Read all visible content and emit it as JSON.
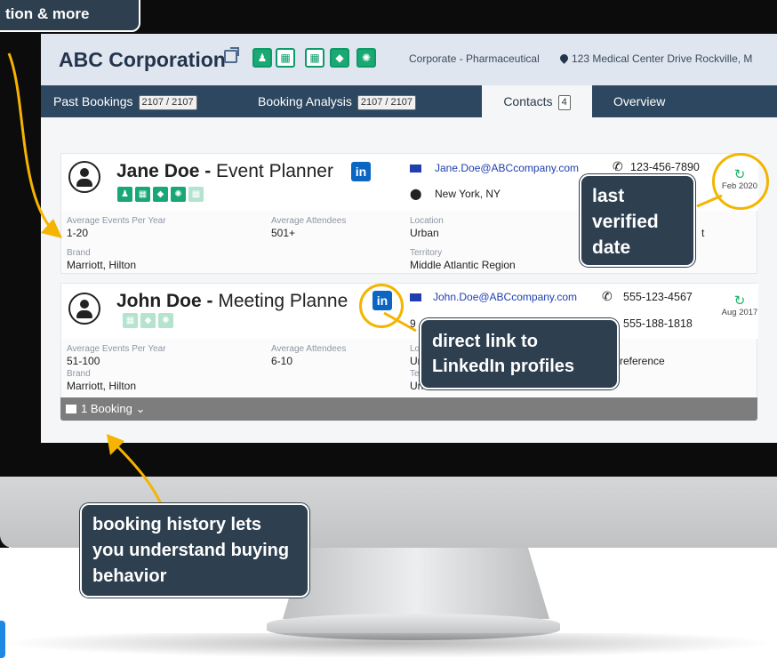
{
  "top_callout": "tion & more",
  "company": {
    "name": "ABC Corporation",
    "category": "Corporate - Pharmaceutical",
    "address": "123 Medical Center Drive Rockville, M"
  },
  "tabs": [
    {
      "label": "Past Bookings",
      "count": "2107 / 2107"
    },
    {
      "label": "Booking Analysis",
      "count": "2107 / 2107"
    },
    {
      "label": "Contacts",
      "count": "4"
    },
    {
      "label": "Overview",
      "count": ""
    }
  ],
  "contacts": [
    {
      "name": "Jane Doe",
      "separator": " - ",
      "title": "Event Planner",
      "email": "Jane.Doe@ABCcompany.com",
      "phone": "123-456-7890",
      "location": "New York, NY",
      "verified_date": "Feb 2020",
      "fields": {
        "avg_events_label": "Average Events Per Year",
        "avg_events": "1-20",
        "avg_attendees_label": "Average Attendees",
        "avg_attendees": "501+",
        "location_label": "Location",
        "location": "Urban",
        "brand_label": "Brand",
        "brand": "Marriott, Hilton",
        "territory_label": "Territory",
        "territory": "Middle Atlantic Region",
        "extra_fragment": "t"
      }
    },
    {
      "name": "John Doe",
      "separator": " - ",
      "title": "Meeting Planne",
      "email": "John.Doe@ABCcompany.com",
      "phone": "555-123-4567",
      "phone2": "555-188-1818",
      "location_fragment": "9",
      "verified_date": "Aug 2017",
      "fields": {
        "avg_events_label": "Average Events Per Year",
        "avg_events": "51-100",
        "avg_attendees_label": "Average Attendees",
        "avg_attendees": "6-10",
        "location_label_fragment": "Lo",
        "location_fragment": "Ur",
        "territory_label_fragment": "Te",
        "brand_label": "Brand",
        "brand": "Marriott, Hilton",
        "territory": "United States of America",
        "extra_fragment": "reference",
        "extra_label_fragment": "n"
      }
    }
  ],
  "booking_bar": {
    "label": "1 Booking"
  },
  "callouts": {
    "last_verified": "last verified date",
    "linkedin": "direct link to LinkedIn profiles",
    "booking_history": "booking history lets you understand buying behavior"
  },
  "colors": {
    "accent_green": "#1aa873",
    "linkedin": "#0a66c2",
    "callout_bg": "#2e3f4f",
    "highlight": "#f4b400",
    "tabbar": "#2d4760"
  }
}
